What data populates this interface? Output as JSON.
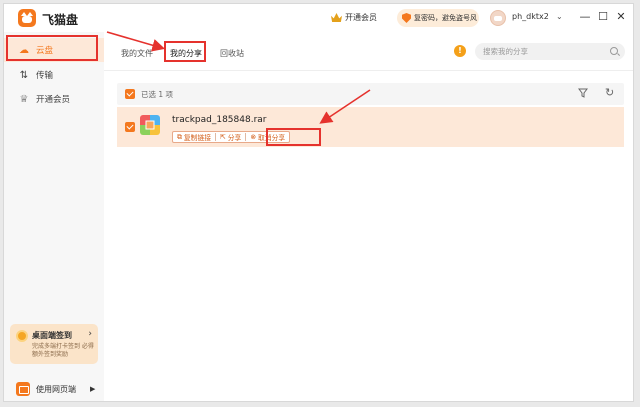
{
  "app": {
    "title": "飞猫盘"
  },
  "titlebar": {
    "vip_link": "开通会员",
    "notice": "复密码，避免盗号风",
    "username": "ph_dktx2",
    "minimize": "—",
    "maximize": "☐",
    "close": "✕"
  },
  "sidebar": {
    "items": [
      {
        "label": "云盘",
        "icon": "cloud-icon",
        "active": true
      },
      {
        "label": "传输",
        "icon": "transfer-icon",
        "active": false
      },
      {
        "label": "开通会员",
        "icon": "vip-icon",
        "active": false
      }
    ],
    "signin": {
      "title": "桌面端签到",
      "subtitle": "完成多端打卡签到 必得额外签到奖励"
    },
    "web_version": "使用网页端"
  },
  "tabs": [
    {
      "label": "我的文件",
      "active": false
    },
    {
      "label": "我的分享",
      "active": true
    },
    {
      "label": "回收站",
      "active": false
    }
  ],
  "search": {
    "placeholder": "搜索我的分享"
  },
  "list": {
    "selected_text": "已选 1 项",
    "rows": [
      {
        "filename": "trackpad_185848.rar",
        "actions": [
          "复制链接",
          "分享",
          "取消分享"
        ]
      }
    ]
  },
  "colors": {
    "accent": "#f4781e",
    "highlight": "#e5322d",
    "selected_row": "#fde8d8"
  }
}
